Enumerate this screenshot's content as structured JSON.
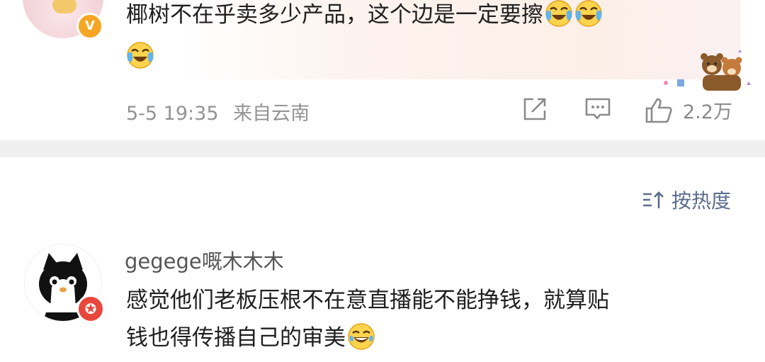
{
  "top_comment": {
    "line1": "椰树不在乎卖多少产品，这个边是一定要擦",
    "emoji_name": "laughing-crying-emoji",
    "date": "5-5 19:35",
    "location": "来自云南",
    "like_count": "2.2万",
    "badge": "V"
  },
  "sort": {
    "label": "按热度"
  },
  "comment": {
    "username": "gegege嘅木木木",
    "text_line1": "感觉他们老板压根不在意直播能不能挣钱，就算贴",
    "text_line2": "钱也得传播自己的审美",
    "emoji_name": "laughing-tears-emoji"
  },
  "colors": {
    "accent_blue": "#5a6d8c",
    "badge_gold": "#f5a623",
    "badge_red": "#e8473c",
    "meta_gray": "#939393",
    "divider": "#efefef"
  }
}
